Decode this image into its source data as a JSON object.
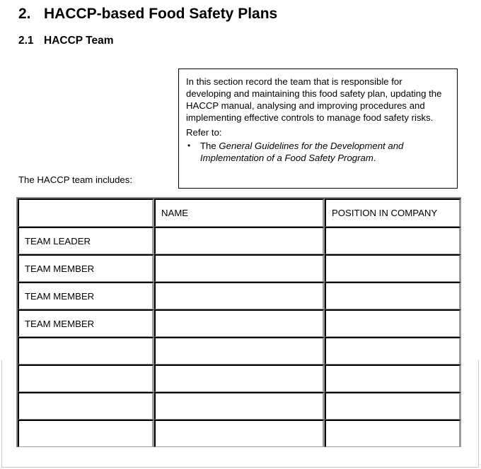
{
  "heading": {
    "number": "2.",
    "title": "HACCP-based Food Safety Plans"
  },
  "subheading": {
    "number": "2.1",
    "title": "HACCP Team"
  },
  "note_box": {
    "text": "In this section record the team that is responsible for developing and maintaining this food safety plan, updating the HACCP manual, analysing and improving procedures and implementing effective controls to manage food safety risks.",
    "refer_label": "Refer to:",
    "bullet_icon": "•",
    "bullet_prefix": "The ",
    "bullet_italic": "General Guidelines for the Development and Implementation of a Food Safety Program",
    "bullet_suffix": "."
  },
  "intro_text": "The HACCP team includes:",
  "table": {
    "headers": [
      "",
      "NAME",
      "POSITION IN COMPANY"
    ],
    "rows": [
      {
        "role": "TEAM LEADER",
        "name": "",
        "position": ""
      },
      {
        "role": "TEAM MEMBER",
        "name": "",
        "position": ""
      },
      {
        "role": "TEAM MEMBER",
        "name": "",
        "position": ""
      },
      {
        "role": "TEAM MEMBER",
        "name": "",
        "position": ""
      },
      {
        "role": "",
        "name": "",
        "position": ""
      },
      {
        "role": "",
        "name": "",
        "position": ""
      },
      {
        "role": "",
        "name": "",
        "position": ""
      },
      {
        "role": "",
        "name": "",
        "position": ""
      }
    ]
  }
}
